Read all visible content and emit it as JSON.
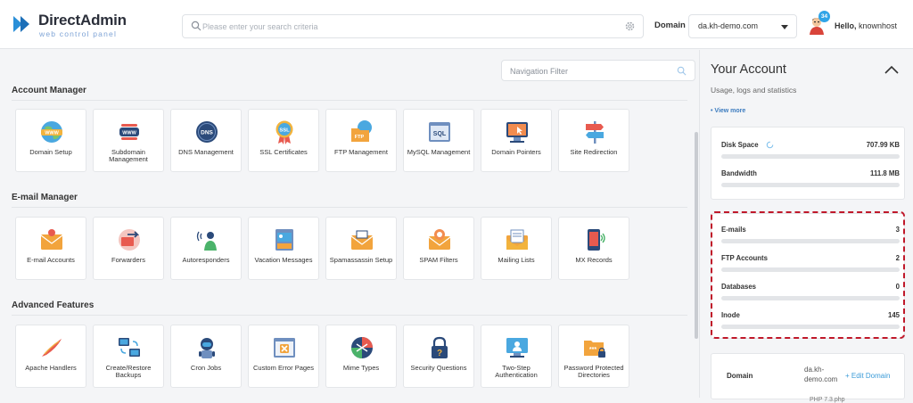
{
  "header": {
    "logo_title": "DirectAdmin",
    "logo_subtitle": "web control panel",
    "search_placeholder": "Please enter your search criteria",
    "domain_label": "Domain",
    "domain_value": "da.kh-demo.com",
    "badge_count": "34",
    "hello_prefix": "Hello,",
    "username": "knownhost"
  },
  "main": {
    "nav_filter_placeholder": "Navigation Filter",
    "sections": [
      {
        "title": "Account Manager",
        "items": [
          {
            "label": "Domain Setup",
            "icon": "globe-www-icon"
          },
          {
            "label": "Subdomain Management",
            "icon": "subdomain-www-icon"
          },
          {
            "label": "DNS Management",
            "icon": "dns-globe-icon"
          },
          {
            "label": "SSL Certificates",
            "icon": "ssl-badge-icon"
          },
          {
            "label": "FTP Management",
            "icon": "ftp-folder-icon"
          },
          {
            "label": "MySQL Management",
            "icon": "sql-database-icon"
          },
          {
            "label": "Domain Pointers",
            "icon": "monitor-pointer-icon"
          },
          {
            "label": "Site Redirection",
            "icon": "signpost-icon"
          }
        ]
      },
      {
        "title": "E-mail Manager",
        "items": [
          {
            "label": "E-mail Accounts",
            "icon": "envelope-user-icon"
          },
          {
            "label": "Forwarders",
            "icon": "forward-arrow-icon"
          },
          {
            "label": "Autoresponders",
            "icon": "autoresponder-person-icon"
          },
          {
            "label": "Vacation Messages",
            "icon": "vacation-calendar-icon"
          },
          {
            "label": "Spamassassin Setup",
            "icon": "spam-envelope-icon"
          },
          {
            "label": "SPAM Filters",
            "icon": "spam-filter-icon"
          },
          {
            "label": "Mailing Lists",
            "icon": "mailing-list-icon"
          },
          {
            "label": "MX Records",
            "icon": "mx-phone-icon"
          }
        ]
      },
      {
        "title": "Advanced Features",
        "items": [
          {
            "label": "Apache Handlers",
            "icon": "apache-feather-icon"
          },
          {
            "label": "Create/Restore Backups",
            "icon": "backup-computers-icon"
          },
          {
            "label": "Cron Jobs",
            "icon": "robot-icon"
          },
          {
            "label": "Custom Error Pages",
            "icon": "error-page-icon"
          },
          {
            "label": "Mime Types",
            "icon": "mime-arrows-icon"
          },
          {
            "label": "Security Questions",
            "icon": "lock-question-icon"
          },
          {
            "label": "Two-Step Authentication",
            "icon": "two-step-auth-icon"
          },
          {
            "label": "Password Protected Directories",
            "icon": "protected-folder-icon"
          }
        ]
      }
    ]
  },
  "sidebar": {
    "title": "Your Account",
    "subtitle": "Usage, logs and statistics",
    "view_more": "• View more",
    "disk_space_label": "Disk Space",
    "disk_space_value": "707.99 KB",
    "bandwidth_label": "Bandwidth",
    "bandwidth_value": "111.8 MB",
    "emails_label": "E-mails",
    "emails_value": "3",
    "ftp_label": "FTP Accounts",
    "ftp_value": "2",
    "db_label": "Databases",
    "db_value": "0",
    "inode_label": "Inode",
    "inode_value": "145",
    "domain_key": "Domain",
    "domain_value": "da.kh-demo.com",
    "edit_domain": "+ Edit Domain",
    "php_text": "PHP 7.3.php"
  },
  "colors": {
    "accent": "#3b9bd8",
    "highlight": "#c0182a",
    "badge": "#2fa4e7"
  }
}
